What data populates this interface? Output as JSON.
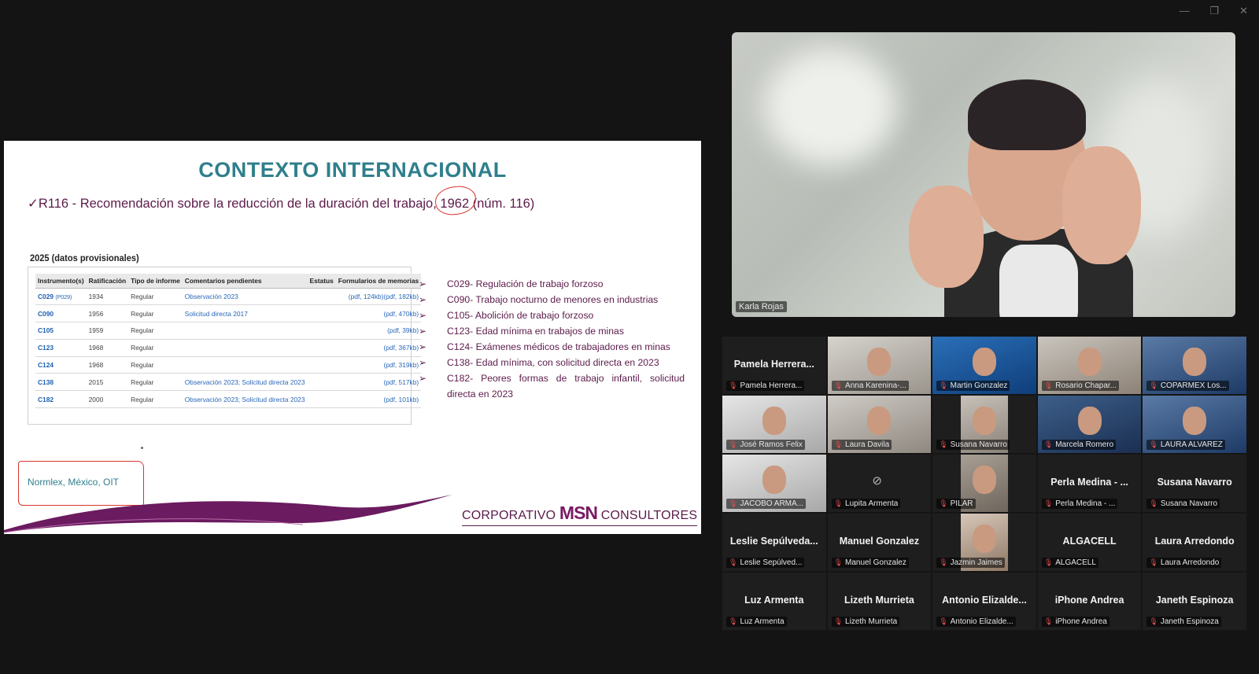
{
  "window_controls": {
    "minimize": "—",
    "restore": "❐",
    "close": "✕"
  },
  "slide": {
    "title": "CONTEXTO INTERNACIONAL",
    "subtitle_prefix": "✓R116 - Recomendación sobre la reducción de la duración del trabajo, ",
    "subtitle_year": "1962",
    "subtitle_suffix": " (núm. 116)",
    "table_caption": "2025 (datos provisionales)",
    "table_headers": [
      "Instrumento(s)",
      "Ratificación",
      "Tipo de informe",
      "Comentarios pendientes",
      "Estatus",
      "Formularios de memorias"
    ],
    "table_rows": [
      {
        "code": "C029",
        "extra": "(P029)",
        "year": "1934",
        "type": "Regular",
        "comments": "Observación 2023",
        "status": "",
        "forms": "(pdf, 124kb)(pdf, 182kb)"
      },
      {
        "code": "C090",
        "extra": "",
        "year": "1956",
        "type": "Regular",
        "comments": "Solicitud directa 2017",
        "status": "",
        "forms": "(pdf, 470kb)"
      },
      {
        "code": "C105",
        "extra": "",
        "year": "1959",
        "type": "Regular",
        "comments": "",
        "status": "",
        "forms": "(pdf, 39kb)"
      },
      {
        "code": "C123",
        "extra": "",
        "year": "1968",
        "type": "Regular",
        "comments": "",
        "status": "",
        "forms": "(pdf, 367kb)"
      },
      {
        "code": "C124",
        "extra": "",
        "year": "1968",
        "type": "Regular",
        "comments": "",
        "status": "",
        "forms": "(pdf, 319kb)"
      },
      {
        "code": "C138",
        "extra": "",
        "year": "2015",
        "type": "Regular",
        "comments": "Observación 2023; Solicitud directa 2023",
        "status": "",
        "forms": "(pdf, 517kb)"
      },
      {
        "code": "C182",
        "extra": "",
        "year": "2000",
        "type": "Regular",
        "comments": "Observación 2023; Solicitud directa 2023",
        "status": "",
        "forms": "(pdf, 101kb)"
      }
    ],
    "bullets": [
      "C029- Regulación de trabajo forzoso",
      "C090- Trabajo nocturno de menores en industrias",
      " C105- Abolición de trabajo forzoso",
      "C123- Edad mínima en trabajos de minas",
      "C124- Exámenes médicos de trabajadores en minas",
      "C138- Edad mínima, con solicitud directa en 2023",
      "C182- Peores formas de trabajo infantil, solicitud directa en 2023"
    ],
    "source": "Normlex, México, OIT",
    "brand_left": "CORPORATIVO",
    "brand_mid": "MSN",
    "brand_right": "CONSULTORES"
  },
  "speaker": {
    "name": "Karla Rojas"
  },
  "participants": [
    {
      "label": "Pamela Herrera...",
      "big": "Pamela Herrera...",
      "kind": "name"
    },
    {
      "label": "Anna Karenina-...",
      "big": "",
      "kind": "video",
      "cls": "v1"
    },
    {
      "label": "Martin Gonzalez",
      "big": "",
      "kind": "video",
      "cls": "v2"
    },
    {
      "label": "Rosario Chapar...",
      "big": "",
      "kind": "video",
      "cls": "v3"
    },
    {
      "label": "COPARMEX Los...",
      "big": "",
      "kind": "video",
      "cls": "v4"
    },
    {
      "label": "José Ramos Felix",
      "big": "",
      "kind": "video",
      "cls": "v5"
    },
    {
      "label": "Laura Davila",
      "big": "",
      "kind": "video",
      "cls": "v6"
    },
    {
      "label": "Susana Navarro",
      "big": "",
      "kind": "video-small",
      "cls": "v10"
    },
    {
      "label": "Marcela Romero",
      "big": "",
      "kind": "video",
      "cls": "v7"
    },
    {
      "label": "LAURA ALVAREZ",
      "big": "",
      "kind": "video",
      "cls": "v4"
    },
    {
      "label": "JACOBO ARMA...",
      "big": "",
      "kind": "video",
      "cls": "v5"
    },
    {
      "label": "Lupita Armenta",
      "big": "",
      "kind": "camoff"
    },
    {
      "label": "PILAR",
      "big": "",
      "kind": "video-small",
      "cls": "v8"
    },
    {
      "label": "Perla Medina - ...",
      "big": "Perla Medina - ...",
      "kind": "name"
    },
    {
      "label": "Susana Navarro",
      "big": "Susana Navarro",
      "kind": "name"
    },
    {
      "label": "Leslie Sepúlved...",
      "big": "Leslie Sepúlveda...",
      "kind": "name"
    },
    {
      "label": "Manuel Gonzalez",
      "big": "Manuel Gonzalez",
      "kind": "name"
    },
    {
      "label": "Jazmin Jaimes",
      "big": "",
      "kind": "video-small",
      "cls": "v9"
    },
    {
      "label": "ALGACELL",
      "big": "ALGACELL",
      "kind": "name"
    },
    {
      "label": "Laura Arredondo",
      "big": "Laura Arredondo",
      "kind": "name"
    },
    {
      "label": "Luz Armenta",
      "big": "Luz Armenta",
      "kind": "name"
    },
    {
      "label": "Lizeth Murrieta",
      "big": "Lizeth Murrieta",
      "kind": "name"
    },
    {
      "label": "Antonio Elizalde...",
      "big": "Antonio Elizalde...",
      "kind": "name"
    },
    {
      "label": "iPhone Andrea",
      "big": "iPhone Andrea",
      "kind": "name"
    },
    {
      "label": "Janeth Espinoza",
      "big": "Janeth Espinoza",
      "kind": "name"
    }
  ]
}
